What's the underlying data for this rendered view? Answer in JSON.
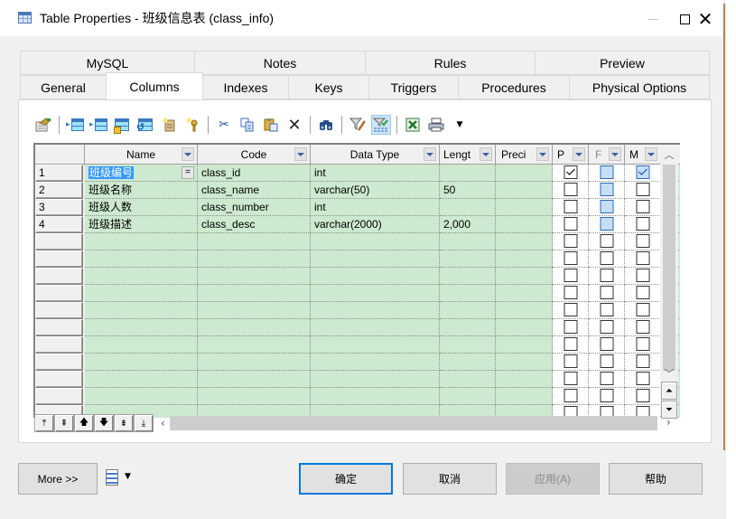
{
  "window": {
    "title": "Table Properties - 班级信息表 (class_info)",
    "controls": {
      "minimize": "—",
      "maximize": "□",
      "close": "✕"
    }
  },
  "tabs": {
    "row1": [
      "MySQL",
      "Notes",
      "Rules",
      "Preview"
    ],
    "row2": [
      "General",
      "Columns",
      "Indexes",
      "Keys",
      "Triggers",
      "Procedures",
      "Physical Options"
    ],
    "active": "Columns"
  },
  "toolbar": {
    "icons": [
      "properties-icon",
      "insert-row-icon",
      "add-row-icon",
      "add-columns-icon",
      "reuse-columns-icon",
      "add-domain-icon",
      "add-key-icon",
      "cut-icon",
      "copy-icon",
      "paste-icon",
      "delete-icon",
      "find-icon",
      "filter-icon",
      "filter-enable-icon",
      "excel-export-icon",
      "print-icon",
      "more-dropdown-icon"
    ],
    "active": "filter-enable-icon"
  },
  "grid": {
    "headers": [
      "Name",
      "Code",
      "Data Type",
      "Lengt",
      "Preci",
      "P",
      "F",
      "M"
    ],
    "rows": [
      {
        "num": "1",
        "name": "班级编号",
        "code": "class_id",
        "data_type": "int",
        "length": "",
        "precision": "",
        "primary": true,
        "foreign": false,
        "mandatory": true,
        "editing": true
      },
      {
        "num": "2",
        "name": "班级名称",
        "code": "class_name",
        "data_type": "varchar(50)",
        "length": "50",
        "precision": "",
        "primary": false,
        "foreign": false,
        "mandatory": false
      },
      {
        "num": "3",
        "name": "班级人数",
        "code": "class_number",
        "data_type": "int",
        "length": "",
        "precision": "",
        "primary": false,
        "foreign": false,
        "mandatory": false
      },
      {
        "num": "4",
        "name": "班级描述",
        "code": "class_desc",
        "data_type": "varchar(2000)",
        "length": "2,000",
        "precision": "",
        "primary": false,
        "foreign": false,
        "mandatory": false
      }
    ],
    "empty_rows": 11,
    "edit_button": "="
  },
  "nav_buttons": [
    "move-top",
    "move-page-up",
    "move-up",
    "move-down",
    "move-page-down",
    "move-bottom"
  ],
  "footer": {
    "more": "More >>",
    "ok": "确定",
    "cancel": "取消",
    "apply": "应用(A)",
    "help": "帮助"
  }
}
